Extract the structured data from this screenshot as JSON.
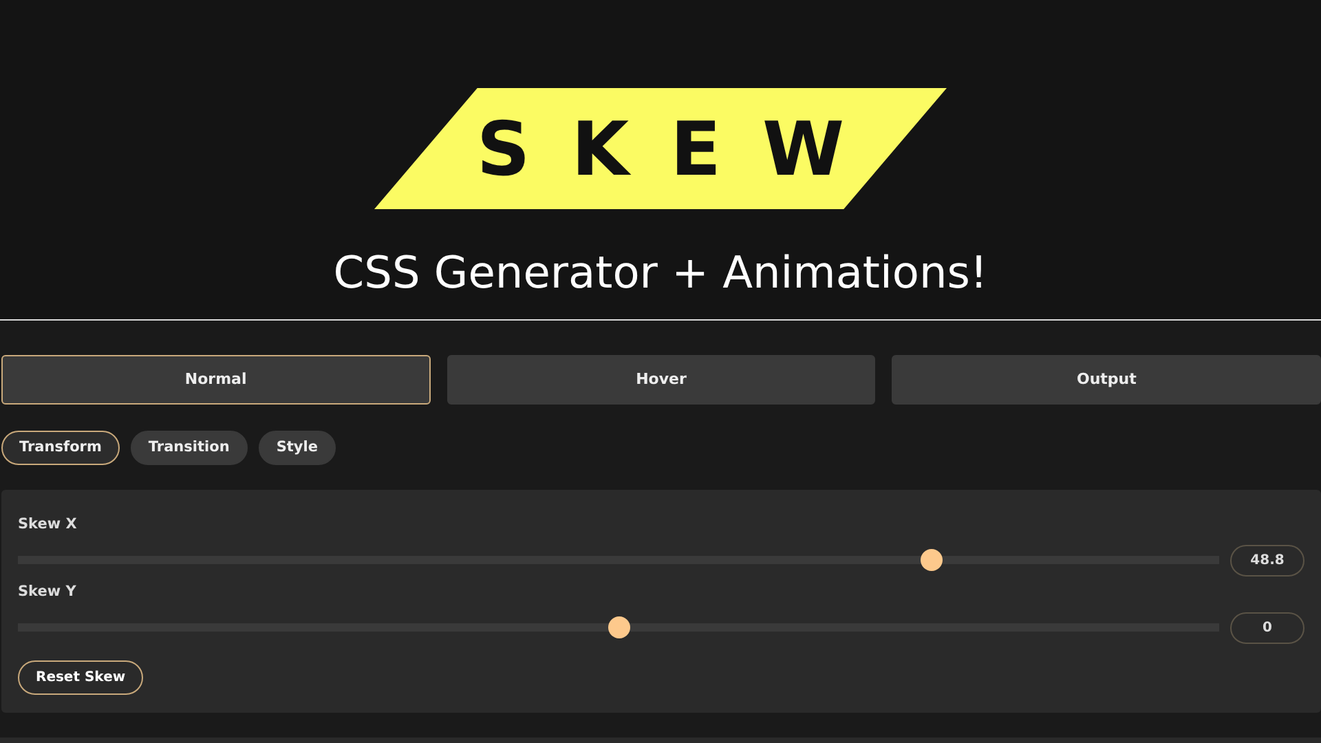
{
  "logo": {
    "text": "SKEW"
  },
  "subtitle": "CSS Generator + Animations!",
  "tabs": [
    {
      "label": "Normal",
      "selected": true
    },
    {
      "label": "Hover",
      "selected": false
    },
    {
      "label": "Output",
      "selected": false
    }
  ],
  "subtabs": [
    {
      "label": "Transform",
      "selected": true
    },
    {
      "label": "Transition",
      "selected": false
    },
    {
      "label": "Style",
      "selected": false
    }
  ],
  "sliders": [
    {
      "label": "Skew X",
      "level": 0.766,
      "value": "48.8"
    },
    {
      "label": "Skew Y",
      "level": 0.5,
      "value": "0"
    }
  ],
  "reset_button": "Reset Skew"
}
